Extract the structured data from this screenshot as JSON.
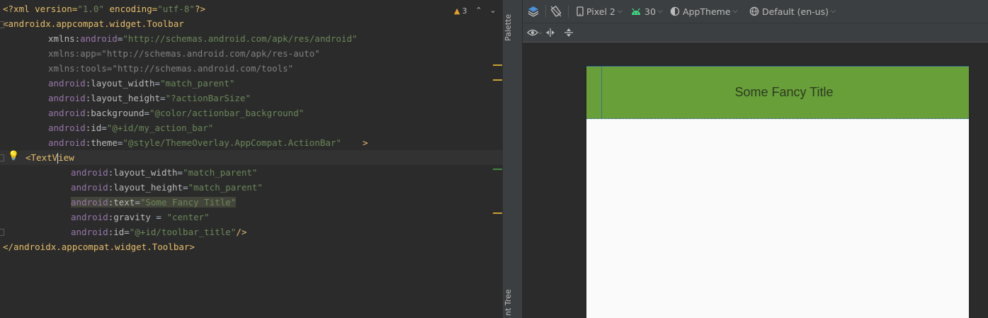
{
  "editor": {
    "warnings": {
      "count": "3"
    },
    "lines": {
      "l1": {
        "a": "<?xml version=",
        "b": "\"1.0\"",
        "c": " encoding=",
        "d": "\"utf-8\"",
        "e": "?>"
      },
      "l2": {
        "tag": "<androidx.appcompat.widget.Toolbar"
      },
      "l3": {
        "ns": "xmlns:",
        "attr": "android",
        "eq": "=",
        "val": "\"http://schemas.android.com/apk/res/android\""
      },
      "l4": {
        "ns": "xmlns:",
        "attr": "app",
        "eq": "=",
        "val": "\"http://schemas.android.com/apk/res-auto\""
      },
      "l5": {
        "ns": "xmlns:",
        "attr": "tools",
        "eq": "=",
        "val": "\"http://schemas.android.com/tools\""
      },
      "l6": {
        "ns": "android",
        "attr": ":layout_width",
        "eq": "=",
        "val": "\"match_parent\""
      },
      "l7": {
        "ns": "android",
        "attr": ":layout_height",
        "eq": "=",
        "val": "\"?actionBarSize\""
      },
      "l8": {
        "ns": "android",
        "attr": ":background",
        "eq": "=",
        "val": "\"@color/actionbar_background\""
      },
      "l9": {
        "ns": "android",
        "attr": ":id",
        "eq": "=",
        "val": "\"@+id/my_action_bar\""
      },
      "l10": {
        "ns": "android",
        "attr": ":theme",
        "eq": "=",
        "val": "\"@style/ThemeOverlay.AppCompat.ActionBar\"",
        "end": "    >"
      },
      "l11": {
        "tag_a": "<TextV",
        "tag_b": "iew"
      },
      "l12": {
        "ns": "android",
        "attr": ":layout_width",
        "eq": "=",
        "val": "\"match_parent\""
      },
      "l13": {
        "ns": "android",
        "attr": ":layout_height",
        "eq": "=",
        "val": "\"match_parent\""
      },
      "l14": {
        "ns": "android",
        "attr": ":text",
        "eq": "=",
        "val": "\"Some Fancy Title\""
      },
      "l15": {
        "ns": "android",
        "attr": ":gravity",
        "eq": " = ",
        "val": "\"center\""
      },
      "l16": {
        "ns": "android",
        "attr": ":id",
        "eq": "=",
        "val": "\"@+id/toolbar_title\"",
        "end": "/>"
      },
      "l17": {
        "tag": "</androidx.appcompat.widget.Toolbar>"
      }
    }
  },
  "sidebar": {
    "palette_label": "Palette",
    "component_tree_label": "nt Tree"
  },
  "design_toolbar": {
    "device": "Pixel 2",
    "api": "30",
    "theme": "AppTheme",
    "locale": "Default (en-us)"
  },
  "preview": {
    "title": "Some Fancy Title"
  },
  "colors": {
    "actionbar_background": "#689f38",
    "editor_background": "#2b2b2b",
    "tag": "#e8bf6a",
    "string": "#6a8759",
    "namespace": "#9876aa"
  }
}
